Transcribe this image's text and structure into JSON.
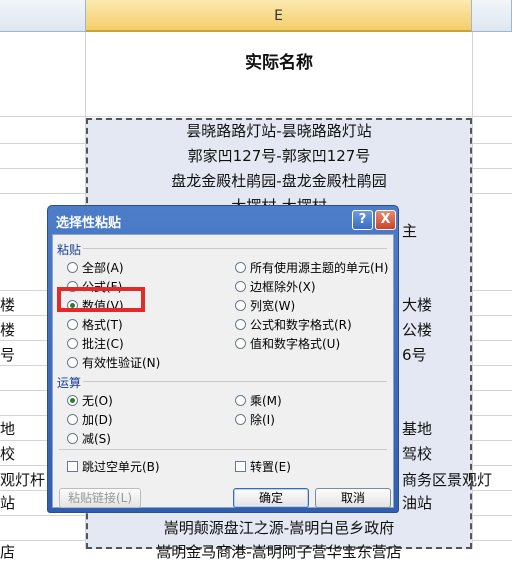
{
  "sheet": {
    "column_label": "E",
    "header": "实际名称",
    "rows": [
      "昙晓路路灯站-昙晓路路灯站",
      "郭家凹127号-郭家凹127号",
      "盘龙金殿杜鹃园-盘龙金殿杜鹃园",
      "大摆村-大摆村",
      "嵩明颠源盘江之源-嵩明白邑乡政府",
      "嵩明金马商港-嵩明阿子营华宝东营店"
    ],
    "right_fragments": [
      "主",
      "大楼",
      "公楼",
      "6号",
      "基地",
      "驾校",
      "商务区景观灯",
      "油站"
    ],
    "left_fragments": [
      "楼",
      "楼",
      "号",
      "地",
      "校",
      "观灯杆",
      "站",
      "店"
    ]
  },
  "dialog": {
    "title": "选择性粘贴",
    "help": "?",
    "close": "X",
    "paste_section": "粘贴",
    "paste_left": [
      "全部(A)",
      "公式(F)",
      "数值(V)",
      "格式(T)",
      "批注(C)",
      "有效性验证(N)"
    ],
    "paste_right": [
      "所有使用源主题的单元(H)",
      "边框除外(X)",
      "列宽(W)",
      "公式和数字格式(R)",
      "值和数字格式(U)"
    ],
    "op_section": "运算",
    "op_left": [
      "无(O)",
      "加(D)",
      "减(S)"
    ],
    "op_right": [
      "乘(M)",
      "除(I)"
    ],
    "skip_blanks": "跳过空单元(B)",
    "transpose": "转置(E)",
    "paste_link": "粘贴链接(L)",
    "ok": "确定",
    "cancel": "取消",
    "selected_paste": "数值(V)",
    "selected_op": "无(O)"
  }
}
